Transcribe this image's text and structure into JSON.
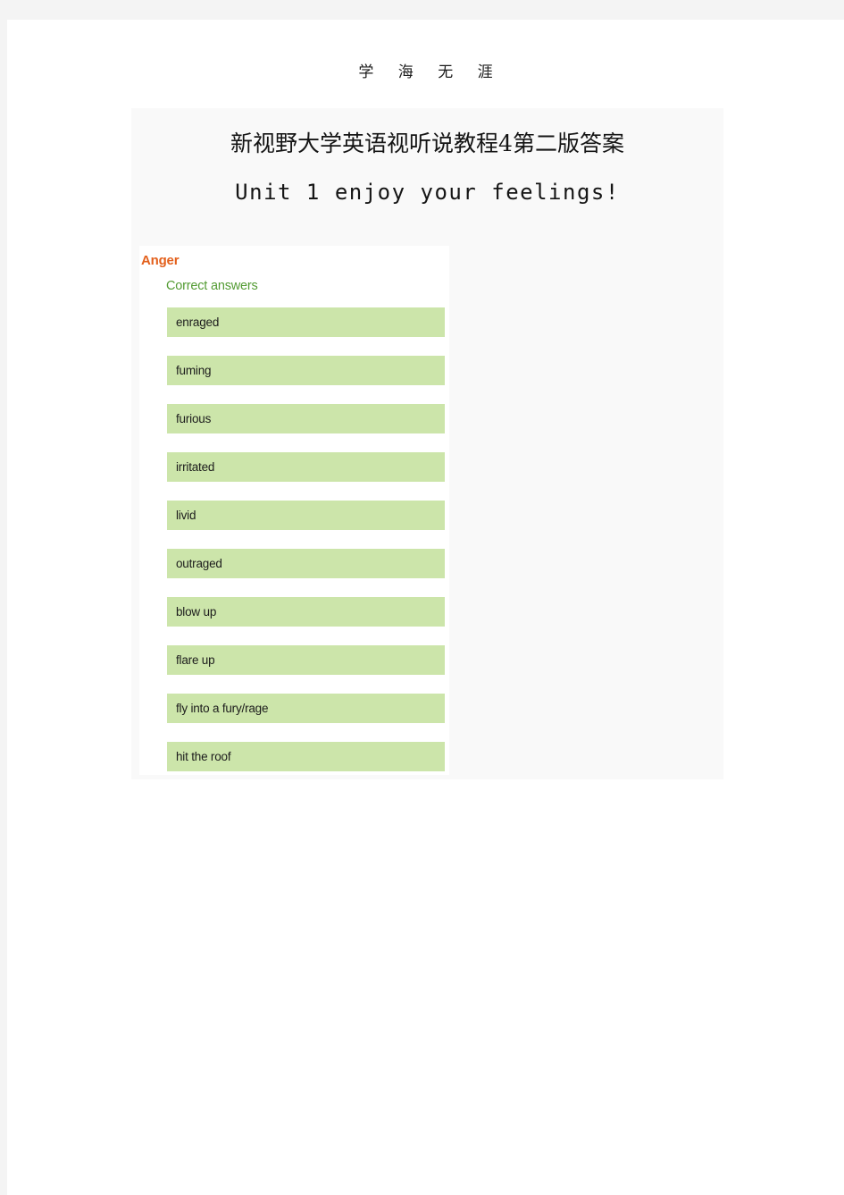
{
  "page": {
    "running_head": "学 海 无 涯",
    "title": "新视野大学英语视听说教程4第二版答案",
    "subtitle": "Unit 1 enjoy your feelings!"
  },
  "colors": {
    "category_orange": "#e3601c",
    "label_green": "#539b33",
    "answer_bar_green": "#cce5aa",
    "panel_background": "#f9f9f9",
    "scan_bleed_gray": "#f4f4f4"
  },
  "quiz": {
    "category": "Anger",
    "correct_answers_label": "Correct answers",
    "answers": [
      "enraged",
      "fuming",
      "furious",
      "irritated",
      "livid",
      "outraged",
      "blow up",
      "flare up",
      "fly into a fury/rage",
      "hit the roof"
    ]
  }
}
